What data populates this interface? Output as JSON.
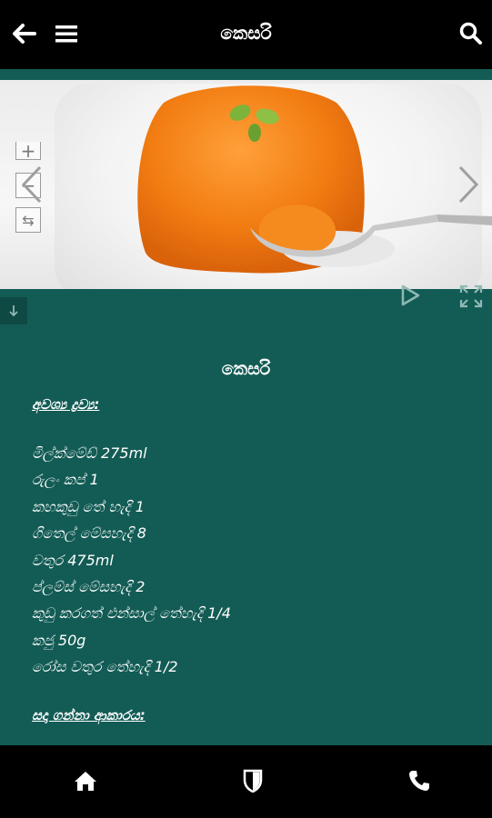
{
  "header": {
    "title": "කෙසරි",
    "icons": {
      "back": "back-arrow-icon",
      "menu": "hamburger-menu-icon",
      "search": "search-icon"
    }
  },
  "gallery": {
    "image_description": "orange kesari pudding with spoon",
    "controls": {
      "zoom_in": "+",
      "zoom_out": "−",
      "rotate": "⇆"
    },
    "icons": {
      "prev": "chevron-left-icon",
      "next": "chevron-right-icon",
      "play": "play-icon",
      "fullscreen": "fullscreen-icon",
      "collapse": "arrow-down-icon"
    }
  },
  "recipe": {
    "title": "කෙසරි",
    "ingredients_heading": "අවශ්‍ය ද්‍රව්‍ය:",
    "ingredients": [
      "මිල්ක්මේඩ් 275ml",
      "රුලං කප් 1",
      "කහකුඩු තේ හැදි 1",
      "ගිතෙල් මේසහැදි 8",
      "වතුර 475ml",
      "ප්ලම්ස් මේසහැදි 2",
      "කුඩු කරගත් එන්සාල් තේහැදි 1/4",
      "කජු 50g",
      "රෝස වතුර තේහැදි 1/2"
    ],
    "method_heading": "සදා ගන්නා ආකාරය:"
  },
  "bottom_nav": {
    "icons": {
      "home": "home-icon",
      "shield": "shield-icon",
      "phone": "phone-icon"
    }
  },
  "colors": {
    "primary": "#135c55",
    "bars": "#000000",
    "text": "#ffffff"
  }
}
